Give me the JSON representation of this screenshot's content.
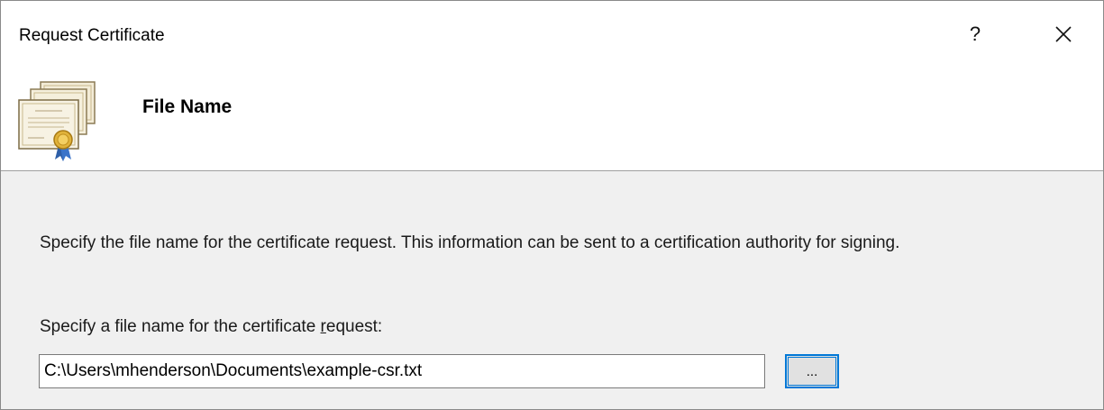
{
  "window": {
    "title": "Request Certificate",
    "help_label": "?",
    "close_icon": "close-icon"
  },
  "header": {
    "icon": "certificate-icon",
    "page_title": "File Name"
  },
  "content": {
    "description": "Specify the file name for the certificate request. This information can be sent to a certification authority for signing.",
    "field_label_before": "Specify a file name for the certificate ",
    "field_label_mnemonic": "r",
    "field_label_after": "equest:",
    "file_path": "C:\\Users\\mhenderson\\Documents\\example-csr.txt",
    "browse_label": "..."
  },
  "colors": {
    "accent": "#0078d7",
    "body_background": "#f0f0f0",
    "header_background": "#ffffff"
  }
}
